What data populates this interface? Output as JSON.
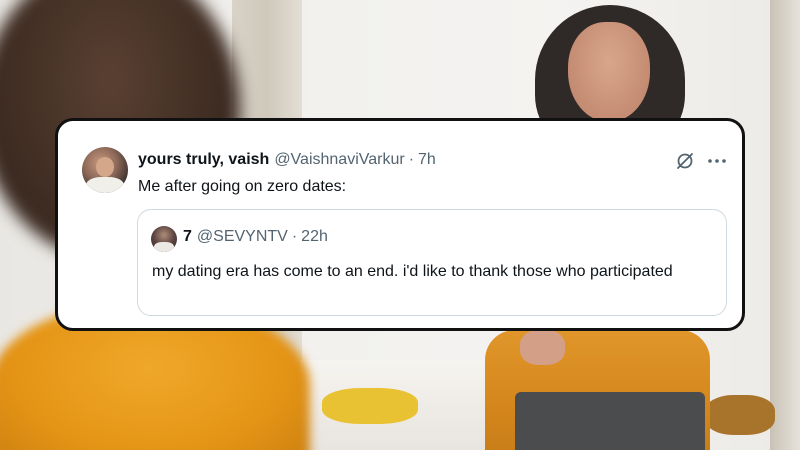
{
  "tweet": {
    "display_name": "yours truly, vaish",
    "handle": "@VaishnaviVarkur",
    "separator": "·",
    "time": "7h",
    "text": "Me after going on zero dates:",
    "icons": [
      "grok-icon",
      "more-icon"
    ]
  },
  "quoted_tweet": {
    "display_name": "7",
    "handle": "@SEVYNTV",
    "separator": "·",
    "time": "22h",
    "text": "my dating era has come to an end. i'd like to thank those who participated"
  },
  "colors": {
    "card_border": "#111111",
    "primary_text": "#0f1419",
    "secondary_text": "#536471",
    "quote_border": "#cfd9de",
    "background_accent": "#e49415"
  }
}
